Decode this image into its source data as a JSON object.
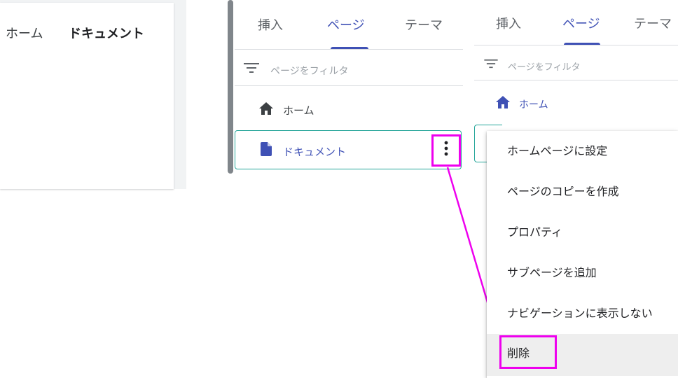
{
  "preview": {
    "nav_home": "ホーム",
    "nav_document": "ドキュメント"
  },
  "panel_a": {
    "tabs": [
      {
        "label": "挿入",
        "active": false
      },
      {
        "label": "ページ",
        "active": true
      },
      {
        "label": "テーマ",
        "active": false
      }
    ],
    "filter_placeholder": "ページをフィルタ",
    "pages": [
      {
        "label": "ホーム",
        "icon": "home-icon"
      },
      {
        "label": "ドキュメント",
        "icon": "document-icon",
        "selected": true
      }
    ]
  },
  "panel_b": {
    "tabs": [
      {
        "label": "挿入",
        "active": false
      },
      {
        "label": "ページ",
        "active": true
      },
      {
        "label": "テーマ",
        "active": false
      }
    ],
    "filter_placeholder": "ページをフィルタ",
    "pages": [
      {
        "label": "ホーム",
        "icon": "home-icon"
      }
    ]
  },
  "context_menu": {
    "items": [
      "ホームページに設定",
      "ページのコピーを作成",
      "プロパティ",
      "サブページを追加",
      "ナビゲーションに表示しない",
      "削除"
    ]
  },
  "colors": {
    "accent": "#3f51b5",
    "selection_border": "#26a69a",
    "highlight_annotation": "#ee00ee"
  }
}
